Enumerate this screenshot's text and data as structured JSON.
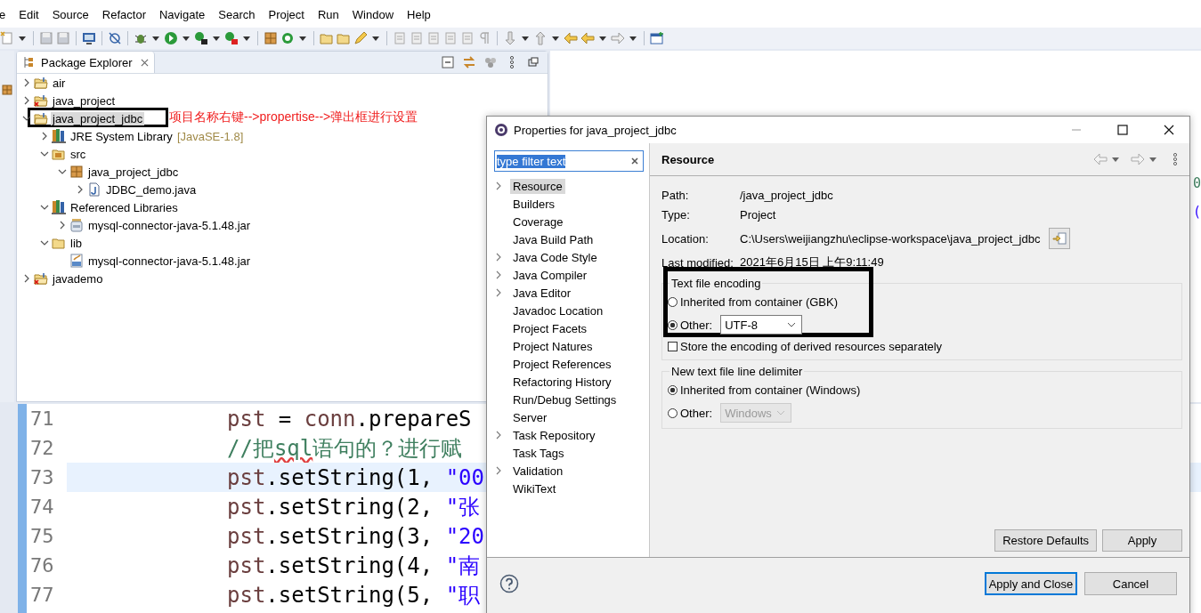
{
  "menu_bar": {
    "items": [
      "e",
      "Edit",
      "Source",
      "Refactor",
      "Navigate",
      "Search",
      "Project",
      "Run",
      "Window",
      "Help"
    ]
  },
  "package_explorer": {
    "title": "Package Explorer",
    "tree": [
      {
        "label": "air",
        "kind": "project",
        "expandable": true,
        "expanded": false,
        "selected": false
      },
      {
        "label": "java_project",
        "kind": "project_error",
        "expandable": true,
        "expanded": false,
        "selected": false
      },
      {
        "label": "java_project_jdbc",
        "kind": "project",
        "expandable": true,
        "expanded": true,
        "selected": true,
        "children": [
          {
            "label": "JRE System Library",
            "decoration": "[JavaSE-1.8]",
            "kind": "library",
            "expandable": true,
            "expanded": false,
            "selected": false
          },
          {
            "label": "src",
            "kind": "source_folder",
            "expandable": true,
            "expanded": true,
            "selected": false,
            "children": [
              {
                "label": "java_project_jdbc",
                "kind": "package",
                "expandable": true,
                "expanded": true,
                "selected": false,
                "children": [
                  {
                    "label": "JDBC_demo.java",
                    "kind": "java_file",
                    "expandable": true,
                    "expanded": false,
                    "selected": false
                  }
                ]
              }
            ]
          },
          {
            "label": "Referenced Libraries",
            "kind": "library",
            "expandable": true,
            "expanded": true,
            "selected": false,
            "children": [
              {
                "label": "mysql-connector-java-5.1.48.jar",
                "kind": "jar",
                "expandable": true,
                "expanded": false,
                "selected": false
              }
            ]
          },
          {
            "label": "lib",
            "kind": "folder",
            "expandable": true,
            "expanded": true,
            "selected": false,
            "children": [
              {
                "label": "mysql-connector-java-5.1.48.jar",
                "kind": "jar_file",
                "expandable": false,
                "expanded": false,
                "selected": false
              }
            ]
          }
        ]
      },
      {
        "label": "javademo",
        "kind": "project_error",
        "expandable": true,
        "expanded": false,
        "selected": false
      }
    ]
  },
  "annotation": {
    "text": "项目名称右键-->propertise-->弹出框进行设置"
  },
  "side_editor": {
    "fragments": [
      {
        "text": "0",
        "kind": "number"
      },
      {
        "text": "(",
        "kind": "paren"
      }
    ]
  },
  "editor": {
    "lines": [
      {
        "number": "71",
        "current": false,
        "segments": [
          {
            "kind": "var",
            "text": "pst"
          },
          {
            "kind": "plain",
            "text": " = "
          },
          {
            "kind": "var",
            "text": "conn"
          },
          {
            "kind": "plain",
            "text": ".prepareS"
          }
        ]
      },
      {
        "number": "72",
        "current": false,
        "segments": [
          {
            "kind": "comment",
            "text": "//把"
          },
          {
            "kind": "typo",
            "text": "sql"
          },
          {
            "kind": "comment",
            "text": "语句的？进行赋"
          }
        ]
      },
      {
        "number": "73",
        "current": true,
        "segments": [
          {
            "kind": "var",
            "text": "pst"
          },
          {
            "kind": "plain",
            "text": ".setString(1, "
          },
          {
            "kind": "string",
            "text": "\"00"
          }
        ]
      },
      {
        "number": "74",
        "current": false,
        "segments": [
          {
            "kind": "var",
            "text": "pst"
          },
          {
            "kind": "plain",
            "text": ".setString(2, "
          },
          {
            "kind": "string",
            "text": "\"张"
          }
        ]
      },
      {
        "number": "75",
        "current": false,
        "segments": [
          {
            "kind": "var",
            "text": "pst"
          },
          {
            "kind": "plain",
            "text": ".setString(3, "
          },
          {
            "kind": "string",
            "text": "\"20"
          }
        ]
      },
      {
        "number": "76",
        "current": false,
        "segments": [
          {
            "kind": "var",
            "text": "pst"
          },
          {
            "kind": "plain",
            "text": ".setString(4, "
          },
          {
            "kind": "string",
            "text": "\"南"
          }
        ]
      },
      {
        "number": "77",
        "current": false,
        "segments": [
          {
            "kind": "var",
            "text": "pst"
          },
          {
            "kind": "plain",
            "text": ".setString(5, "
          },
          {
            "kind": "string",
            "text": "\"职"
          }
        ]
      }
    ]
  },
  "dialog": {
    "title": "Properties for java_project_jdbc",
    "filter": {
      "value": "type filter text"
    },
    "nav": [
      {
        "label": "Resource",
        "expandable": true,
        "selected": true
      },
      {
        "label": "Builders",
        "expandable": false,
        "selected": false
      },
      {
        "label": "Coverage",
        "expandable": false,
        "selected": false
      },
      {
        "label": "Java Build Path",
        "expandable": false,
        "selected": false
      },
      {
        "label": "Java Code Style",
        "expandable": true,
        "selected": false
      },
      {
        "label": "Java Compiler",
        "expandable": true,
        "selected": false
      },
      {
        "label": "Java Editor",
        "expandable": true,
        "selected": false
      },
      {
        "label": "Javadoc Location",
        "expandable": false,
        "selected": false
      },
      {
        "label": "Project Facets",
        "expandable": false,
        "selected": false
      },
      {
        "label": "Project Natures",
        "expandable": false,
        "selected": false
      },
      {
        "label": "Project References",
        "expandable": false,
        "selected": false
      },
      {
        "label": "Refactoring History",
        "expandable": false,
        "selected": false
      },
      {
        "label": "Run/Debug Settings",
        "expandable": false,
        "selected": false
      },
      {
        "label": "Server",
        "expandable": false,
        "selected": false
      },
      {
        "label": "Task Repository",
        "expandable": true,
        "selected": false
      },
      {
        "label": "Task Tags",
        "expandable": false,
        "selected": false
      },
      {
        "label": "Validation",
        "expandable": true,
        "selected": false
      },
      {
        "label": "WikiText",
        "expandable": false,
        "selected": false
      }
    ],
    "page": {
      "title": "Resource",
      "fields": [
        {
          "label": "Path:",
          "value": "/java_project_jdbc",
          "has_button": false
        },
        {
          "label": "Type:",
          "value": "Project",
          "has_button": false
        },
        {
          "label": "Location:",
          "value": "C:\\Users\\weijiangzhu\\eclipse-workspace\\java_project_jdbc",
          "has_button": true
        },
        {
          "label": "Last modified:",
          "value": "2021年6月15日 上午9:11:49",
          "has_button": false
        }
      ],
      "encoding": {
        "title": "Text file encoding",
        "options": [
          {
            "label": "Inherited from container (GBK)",
            "selected": false
          },
          {
            "label": "Other:",
            "selected": true,
            "value": "UTF-8",
            "disabled": false
          }
        ],
        "store_checkbox": {
          "label": "Store the encoding of derived resources separately",
          "checked": false
        }
      },
      "delimiter": {
        "title": "New text file line delimiter",
        "options": [
          {
            "label": "Inherited from container (Windows)",
            "selected": true
          },
          {
            "label": "Other:",
            "selected": false,
            "value": "Windows",
            "disabled": true
          }
        ]
      },
      "buttons": [
        "Restore Defaults",
        "Apply"
      ]
    },
    "footer_buttons": [
      {
        "label": "Apply and Close",
        "default": true
      },
      {
        "label": "Cancel",
        "default": false
      }
    ]
  }
}
